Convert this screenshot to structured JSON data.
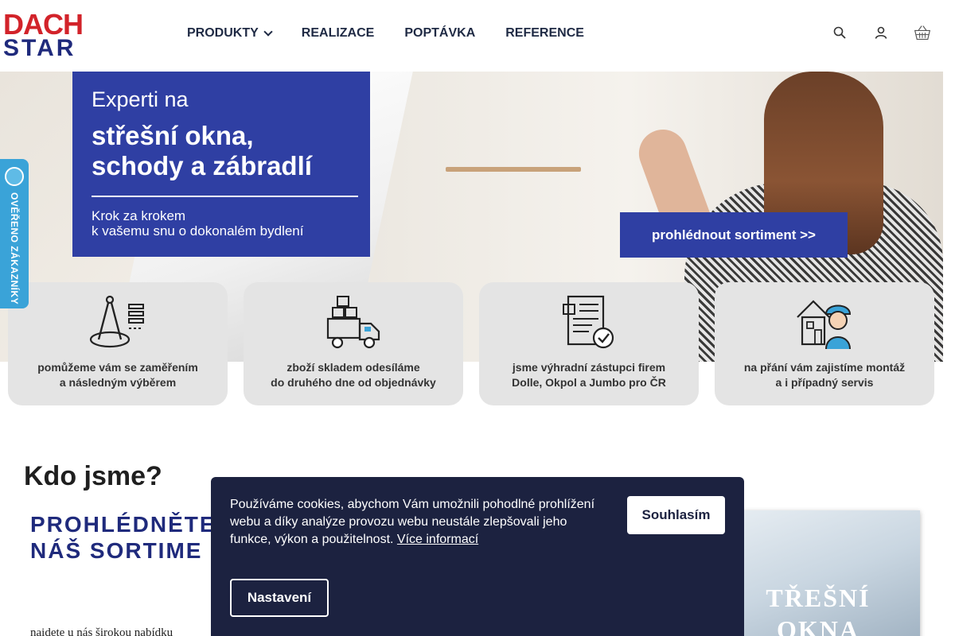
{
  "logo": {
    "top": "DACH",
    "bottom": "STAR",
    "colors": {
      "red": "#d2232a",
      "blue": "#1f2a7c"
    }
  },
  "nav": {
    "items": [
      {
        "label": "PRODUKTY",
        "has_dropdown": true
      },
      {
        "label": "REALIZACE"
      },
      {
        "label": "POPTÁVKA"
      },
      {
        "label": "REFERENCE"
      }
    ]
  },
  "header_icons": [
    "search-icon",
    "user-icon",
    "basket-icon"
  ],
  "hero": {
    "promo_small": "Experti na",
    "promo_big": "střešní okna,\nschody a zábradlí",
    "promo_sub": "Krok za krokem\nk vašemu snu o dokonalém bydlení",
    "cta": "prohlédnout sortiment >>",
    "accent": "#2f3fa3"
  },
  "badge": {
    "text": "OVĚŘENO ZÁKAZNÍKY",
    "color": "#3aa3d8"
  },
  "features": [
    {
      "icon": "measuring-compass-icon",
      "text": "pomůžeme vám se zaměřením\na následným výběrem"
    },
    {
      "icon": "delivery-truck-icon",
      "text": "zboží skladem odesíláme\ndo druhého dne od objednávky"
    },
    {
      "icon": "certificate-document-icon",
      "text": "jsme výhradní zástupci firem\nDolle, Okpol a Jumbo pro ČR"
    },
    {
      "icon": "worker-house-icon",
      "text": "na přání vám zajistíme montáž\na i případný servis"
    }
  ],
  "about": {
    "heading": "Kdo jsme?",
    "sortiment_title": "PROHLÉDNĚTE\nNÁŠ SORTIME",
    "sortiment_text": "naidete u nás širokou nabídku",
    "tile_title": "TŘEŠNÍ\nOKNA"
  },
  "cookie": {
    "text": "Používáme cookies, abychom Vám umožnili pohodlné prohlížení webu a díky analýze provozu webu neustále zlepšovali jeho funkce, výkon a použitelnost.",
    "more_link": "Více informací",
    "agree": "Souhlasím",
    "settings": "Nastavení",
    "bg_color": "#1c2240"
  }
}
